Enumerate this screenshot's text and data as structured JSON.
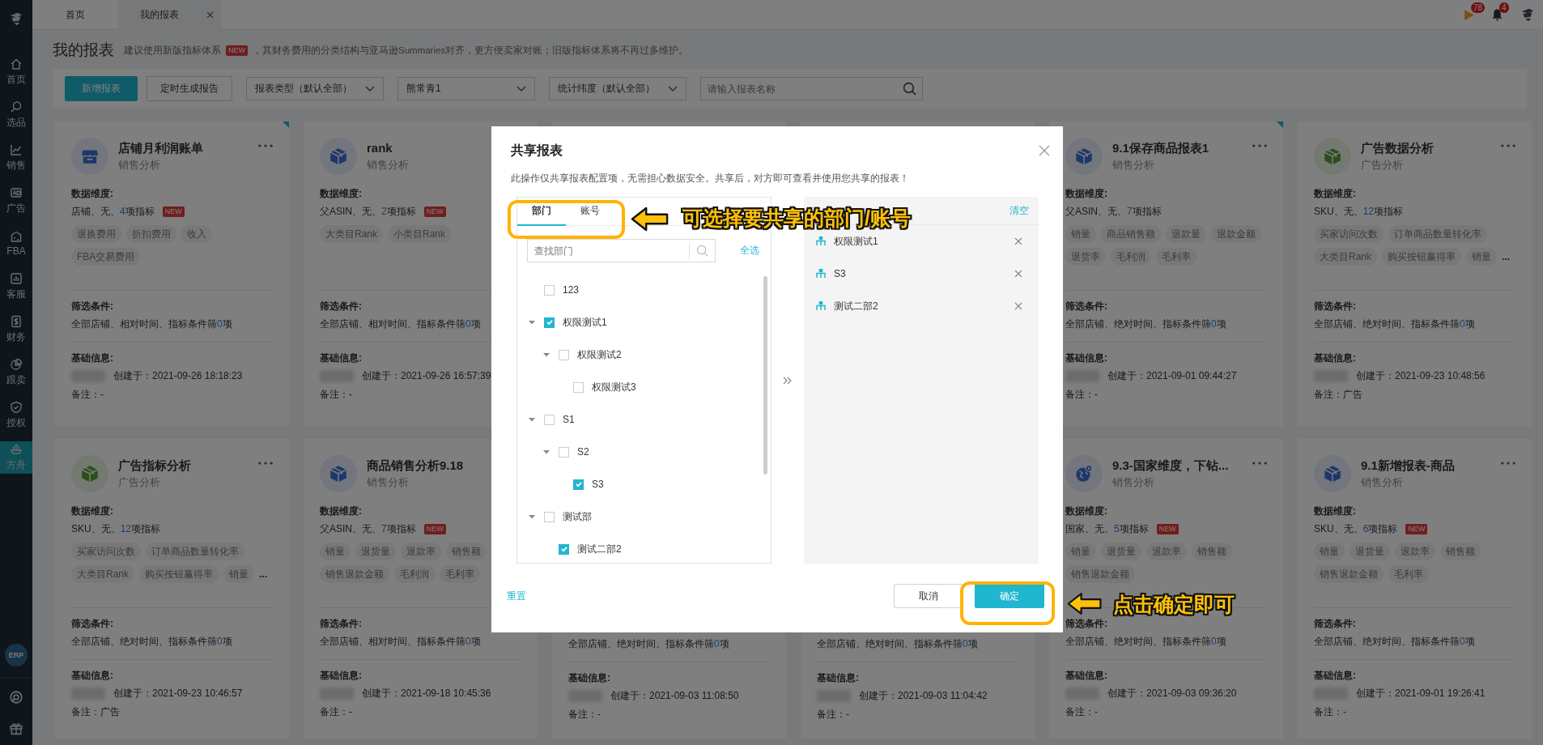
{
  "top_bar": {
    "tabs": [
      {
        "label": "首页",
        "selected": false,
        "closable": false
      },
      {
        "label": "我的报表",
        "selected": true,
        "closable": true
      }
    ],
    "flag_badge": "78",
    "bell_badge": "4"
  },
  "sidebar": {
    "items": [
      {
        "label": "首页",
        "selected": false
      },
      {
        "label": "选品",
        "selected": false
      },
      {
        "label": "销售",
        "selected": false
      },
      {
        "label": "广告",
        "selected": false
      },
      {
        "label": "FBA",
        "selected": false
      },
      {
        "label": "客服",
        "selected": false
      },
      {
        "label": "财务",
        "selected": false
      },
      {
        "label": "跟卖",
        "selected": false
      },
      {
        "label": "授权",
        "selected": false
      },
      {
        "label": "方舟",
        "selected": true
      }
    ],
    "erp": "ERP"
  },
  "page": {
    "title": "我的报表",
    "notice_before": "建议使用新版指标体系",
    "notice_badge": "NEW",
    "notice_after": "，其财务费用的分类结构与亚马逊Summaries对齐，更方便卖家对账；旧版指标体系将不再过多维护。"
  },
  "toolbar": {
    "buttons": [
      {
        "label": "新增报表",
        "kind": "primary"
      },
      {
        "label": "定时生成报告",
        "kind": "default"
      }
    ],
    "selects": [
      {
        "value": "报表类型（默认全部）"
      },
      {
        "value": "熊常青1"
      },
      {
        "value": "统计纬度（默认全部）"
      }
    ],
    "search": {
      "placeholder": "请输入报表名称"
    }
  },
  "cards": [
    {
      "kind": "store",
      "corner_flag": true,
      "title": "店铺月利润账单",
      "category": "销售分析",
      "dims_label": "数据维度:",
      "dims_pre": "店铺、无、",
      "dims_count": "4",
      "dims_post": "项指标",
      "new_badge": "NEW",
      "tags": [
        "退换费用",
        "折扣费用",
        "收入",
        "FBA交易费用"
      ],
      "filter_label": "筛选条件:",
      "filter_pre": "全部店铺、相对时间、指标条件筛",
      "filter_count": "0",
      "filter_post": "项",
      "info_label": "基础信息:",
      "created": "创建于：2021-09-26 18:18:23",
      "note": "备注：-"
    },
    {
      "kind": "box",
      "corner_flag": false,
      "title": "rank",
      "category": "销售分析",
      "dims_label": "数据维度:",
      "dims_pre": "父ASIN、无、",
      "dims_count": "2",
      "dims_post": "项指标",
      "new_badge": "NEW",
      "tags": [
        "大类目Rank",
        "小类目Rank"
      ],
      "filter_label": "筛选条件:",
      "filter_pre": "全部店铺、相对时间、指标条件筛",
      "filter_count": "0",
      "filter_post": "项",
      "info_label": "基础信息:",
      "created": "创建于：2021-09-26 16:57:39",
      "note": "备注：-"
    },
    {
      "kind": "box",
      "corner_flag": true,
      "title": "9.1保存商品报表1",
      "category": "销售分析",
      "dims_label": "数据维度:",
      "dims_pre": "父ASIN、无、",
      "dims_count": "7",
      "dims_post": "项指标",
      "tags": [
        "销量",
        "商品销售额",
        "退款量",
        "退款金额",
        "退货率",
        "毛利润",
        "毛利率"
      ],
      "filter_label": "筛选条件:",
      "filter_pre": "全部店铺、绝对时间、指标条件筛",
      "filter_count": "0",
      "filter_post": "项",
      "info_label": "基础信息:",
      "created": "创建于：2021-09-01 09:44:27",
      "note": "备注：-"
    },
    {
      "kind": "adbox",
      "corner_flag": false,
      "title": "广告数据分析",
      "category": "广告分析",
      "dims_label": "数据维度:",
      "dims_pre": "SKU、无、",
      "dims_count": "12",
      "dims_post": "项指标",
      "tags": [
        "买家访问次数",
        "订单商品数量转化率",
        "大类目Rank",
        "购买按钮赢得率",
        "销量"
      ],
      "tags_more": "...",
      "filter_label": "筛选条件:",
      "filter_pre": "全部店铺、绝对时间、指标条件筛",
      "filter_count": "0",
      "filter_post": "项",
      "info_label": "基础信息:",
      "created": "创建于：2021-09-23 10:48:56",
      "note": "备注：广告"
    },
    {
      "kind": "adbox",
      "corner_flag": false,
      "title": "广告指标分析",
      "category": "广告分析",
      "dims_label": "数据维度:",
      "dims_pre": "SKU、无、",
      "dims_count": "12",
      "dims_post": "项指标",
      "tags": [
        "买家访问次数",
        "订单商品数量转化率",
        "大类目Rank",
        "购买按钮赢得率",
        "销量"
      ],
      "tags_more": "...",
      "filter_label": "筛选条件:",
      "filter_pre": "全部店铺、绝对时间、指标条件筛",
      "filter_count": "0",
      "filter_post": "项",
      "info_label": "基础信息:",
      "created": "创建于：2021-09-23 10:46:57",
      "note": "备注：广告"
    },
    {
      "kind": "box",
      "corner_flag": false,
      "title": "商品销售分析9.18",
      "category": "销售分析",
      "dims_label": "数据维度:",
      "dims_pre": "父ASIN、无、",
      "dims_count": "7",
      "dims_post": "项指标",
      "new_badge": "NEW",
      "tags": [
        "销量",
        "退货量",
        "退款率",
        "销售额",
        "销售退款金额",
        "毛利润",
        "毛利率"
      ],
      "filter_label": "筛选条件:",
      "filter_pre": "全部店铺、相对时间、指标条件筛",
      "filter_count": "0",
      "filter_post": "项",
      "info_label": "基础信息:",
      "created": "创建于：2021-09-18 10:45:36",
      "note": "备注：-"
    },
    {
      "kind": "partial",
      "corner_flag": false,
      "filter_pre": "全部店铺、绝对时间、指标条件筛",
      "filter_count": "0",
      "filter_post": "项",
      "info_label": "基础信息:",
      "created": "创建于：2021-09-03 11:08:50",
      "note": "备注：-"
    },
    {
      "kind": "partial",
      "corner_flag": false,
      "filter_pre": "全部店铺、绝对时间、指标条件筛",
      "filter_count": "0",
      "filter_post": "项",
      "info_label": "基础信息:",
      "created": "创建于：2021-09-03 11:04:42",
      "note": "备注：-"
    },
    {
      "kind": "globe",
      "corner_flag": false,
      "title": "9.3-国家维度，下钻...",
      "category": "销售分析",
      "dims_label": "数据维度:",
      "dims_pre": "国家、无、",
      "dims_count": "5",
      "dims_post": "项指标",
      "new_badge": "NEW",
      "tags": [
        "销量",
        "退货量",
        "退款率",
        "销售额",
        "销售退款金额"
      ],
      "filter_label": "筛选条件:",
      "filter_pre": "全部店铺、绝对时间、指标条件筛",
      "filter_count": "0",
      "filter_post": "项",
      "info_label": "基础信息:",
      "created": "创建于：2021-09-03 09:36:20",
      "note": "备注：-"
    },
    {
      "kind": "box",
      "corner_flag": false,
      "title": "9.1新增报表-商品",
      "category": "销售分析",
      "dims_label": "数据维度:",
      "dims_pre": "SKU、无、",
      "dims_count": "6",
      "dims_post": "项指标",
      "new_badge": "NEW",
      "tags": [
        "销量",
        "退货量",
        "退款率",
        "销售额",
        "销售退款金额",
        "毛利率"
      ],
      "filter_label": "筛选条件:",
      "filter_pre": "全部店铺、绝对时间、指标条件筛",
      "filter_count": "0",
      "filter_post": "项",
      "info_label": "基础信息:",
      "created": "创建于：2021-09-01 19:26:41",
      "note": "备注：-"
    }
  ],
  "dialog": {
    "title": "共享报表",
    "description": "此操作仅共享报表配置项，无需担心数据安全。共享后，对方即可查看并使用您共享的报表！",
    "tabs": [
      {
        "label": "部门",
        "selected": true
      },
      {
        "label": "账号",
        "selected": false
      }
    ],
    "search": {
      "placeholder": "查找部门"
    },
    "select_all": "全选",
    "clear": "清空",
    "tree": [
      {
        "label": "123",
        "checked": false
      },
      {
        "label": "权限测试1",
        "checked": true,
        "expanded": true,
        "children": [
          {
            "label": "权限测试2",
            "checked": false,
            "expanded": true,
            "children": [
              {
                "label": "权限测试3",
                "checked": false
              }
            ]
          }
        ]
      },
      {
        "label": "S1",
        "checked": false,
        "expanded": true,
        "children": [
          {
            "label": "S2",
            "checked": false,
            "expanded": true,
            "children": [
              {
                "label": "S3",
                "checked": true
              }
            ]
          }
        ]
      },
      {
        "label": "测试部",
        "checked": false,
        "expanded": true,
        "children": [
          {
            "label": "测试二部2",
            "checked": true
          }
        ]
      }
    ],
    "selected_items": [
      {
        "label": "权限测试1"
      },
      {
        "label": "S3"
      },
      {
        "label": "测试二部2"
      }
    ],
    "reset": "重置",
    "cancel": "取消",
    "confirm": "确定"
  },
  "callouts": [
    {
      "text": "可选择要共享的部门/账号"
    },
    {
      "text": "点击确定即可"
    }
  ]
}
